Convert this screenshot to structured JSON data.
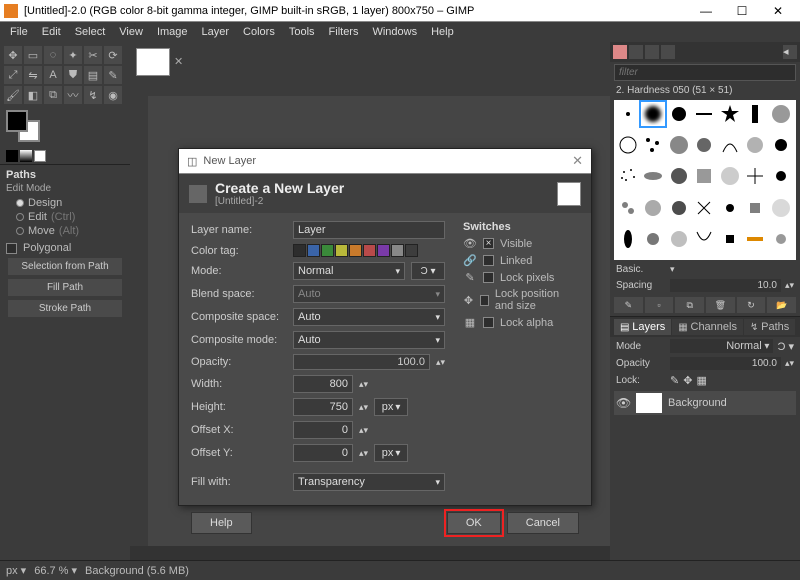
{
  "window": {
    "title": "[Untitled]-2.0 (RGB color 8-bit gamma integer, GIMP built-in sRGB, 1 layer) 800x750 – GIMP",
    "minimize": "—",
    "maximize": "☐",
    "close": "✕"
  },
  "menu": [
    "File",
    "Edit",
    "Select",
    "View",
    "Image",
    "Layer",
    "Colors",
    "Tools",
    "Filters",
    "Windows",
    "Help"
  ],
  "paths": {
    "title": "Paths",
    "edit_mode": "Edit Mode",
    "options": [
      {
        "label": "Design",
        "hint": ""
      },
      {
        "label": "Edit",
        "hint": "(Ctrl)"
      },
      {
        "label": "Move",
        "hint": "(Alt)"
      }
    ],
    "polygonal": "Polygonal",
    "buttons": [
      "Selection from Path",
      "Fill Path",
      "Stroke Path"
    ]
  },
  "right": {
    "filter_placeholder": "filter",
    "brush_info": "2. Hardness 050 (51 × 51)",
    "basic": "Basic.",
    "spacing_label": "Spacing",
    "spacing_value": "10.0",
    "tabs": [
      "Layers",
      "Channels",
      "Paths"
    ],
    "mode_label": "Mode",
    "mode_value": "Normal",
    "opacity_label": "Opacity",
    "opacity_value": "100.0",
    "lock_label": "Lock:",
    "layer_name": "Background"
  },
  "dialog": {
    "titlebar": "New Layer",
    "header": "Create a New Layer",
    "subtitle": "[Untitled]-2",
    "fields": {
      "layer_name_label": "Layer name:",
      "layer_name_value": "Layer",
      "color_tag_label": "Color tag:",
      "mode_label": "Mode:",
      "mode_value": "Normal",
      "blend_label": "Blend space:",
      "blend_value": "Auto",
      "comp_space_label": "Composite space:",
      "comp_space_value": "Auto",
      "comp_mode_label": "Composite mode:",
      "comp_mode_value": "Auto",
      "opacity_label": "Opacity:",
      "opacity_value": "100.0",
      "width_label": "Width:",
      "width_value": "800",
      "height_label": "Height:",
      "height_value": "750",
      "offx_label": "Offset X:",
      "offx_value": "0",
      "offy_label": "Offset Y:",
      "offy_value": "0",
      "unit": "px",
      "fill_label": "Fill with:",
      "fill_value": "Transparency"
    },
    "color_tags": [
      "#2d2d2d",
      "#3a64a8",
      "#3a8a3a",
      "#b8b83a",
      "#c97a2b",
      "#b84a4a",
      "#7a3aa8",
      "#888",
      "#3d3d3d"
    ],
    "switches": {
      "title": "Switches",
      "items": [
        {
          "icon": "👁",
          "label": "Visible",
          "checked": true
        },
        {
          "icon": "🔗",
          "label": "Linked",
          "checked": false
        },
        {
          "icon": "✎",
          "label": "Lock pixels",
          "checked": false
        },
        {
          "icon": "✥",
          "label": "Lock position and size",
          "checked": false
        },
        {
          "icon": "▦",
          "label": "Lock alpha",
          "checked": false
        }
      ]
    },
    "buttons": {
      "help": "Help",
      "ok": "OK",
      "cancel": "Cancel"
    }
  },
  "status": {
    "unit": "px",
    "zoom": "66.7 %",
    "info": "Background (5.6 MB)"
  }
}
